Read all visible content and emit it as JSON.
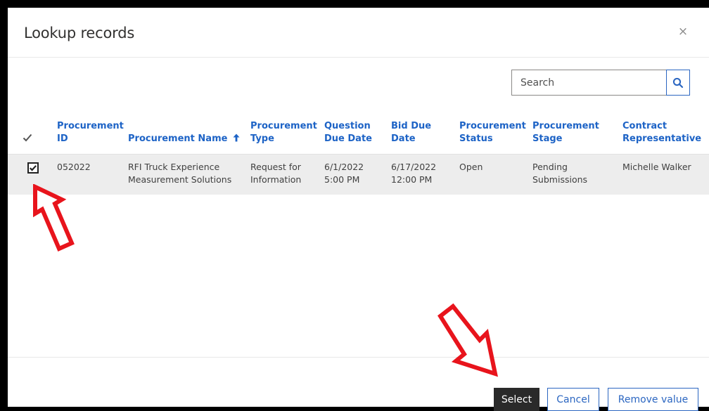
{
  "dialog": {
    "title": "Lookup records",
    "close_label": "×"
  },
  "search": {
    "placeholder": "Search"
  },
  "table": {
    "columns": [
      {
        "key": "id",
        "label_line1": "Procurement",
        "label_line2": "ID"
      },
      {
        "key": "name",
        "label_line1": "",
        "label_line2": "Procurement Name"
      },
      {
        "key": "type",
        "label_line1": "Procurement",
        "label_line2": "Type"
      },
      {
        "key": "question_due",
        "label_line1": "Question",
        "label_line2": "Due Date"
      },
      {
        "key": "bid_due",
        "label_line1": "Bid Due",
        "label_line2": "Date"
      },
      {
        "key": "status",
        "label_line1": "Procurement",
        "label_line2": "Status"
      },
      {
        "key": "stage",
        "label_line1": "Procurement",
        "label_line2": "Stage"
      },
      {
        "key": "rep",
        "label_line1": "Contract",
        "label_line2": "Representative"
      }
    ],
    "sort_icon": "arrow-up-icon",
    "rows": [
      {
        "selected": true,
        "id": "052022",
        "name_line1": "RFI Truck Experience",
        "name_line2": "Measurement Solutions",
        "type_line1": "Request for",
        "type_line2": "Information",
        "question_due_line1": "6/1/2022",
        "question_due_line2": "5:00 PM",
        "bid_due_line1": "6/17/2022",
        "bid_due_line2": "12:00 PM",
        "status": "Open",
        "stage_line1": "Pending",
        "stage_line2": "Submissions",
        "rep": "Michelle Walker"
      }
    ]
  },
  "footer": {
    "select_label": "Select",
    "cancel_label": "Cancel",
    "remove_label": "Remove value"
  },
  "colors": {
    "accent": "#2b66c1",
    "header_text": "#1d63c6",
    "row_selected": "#ededed",
    "select_button": "#2a2a2a",
    "annotation_arrow": "#e8141c"
  }
}
